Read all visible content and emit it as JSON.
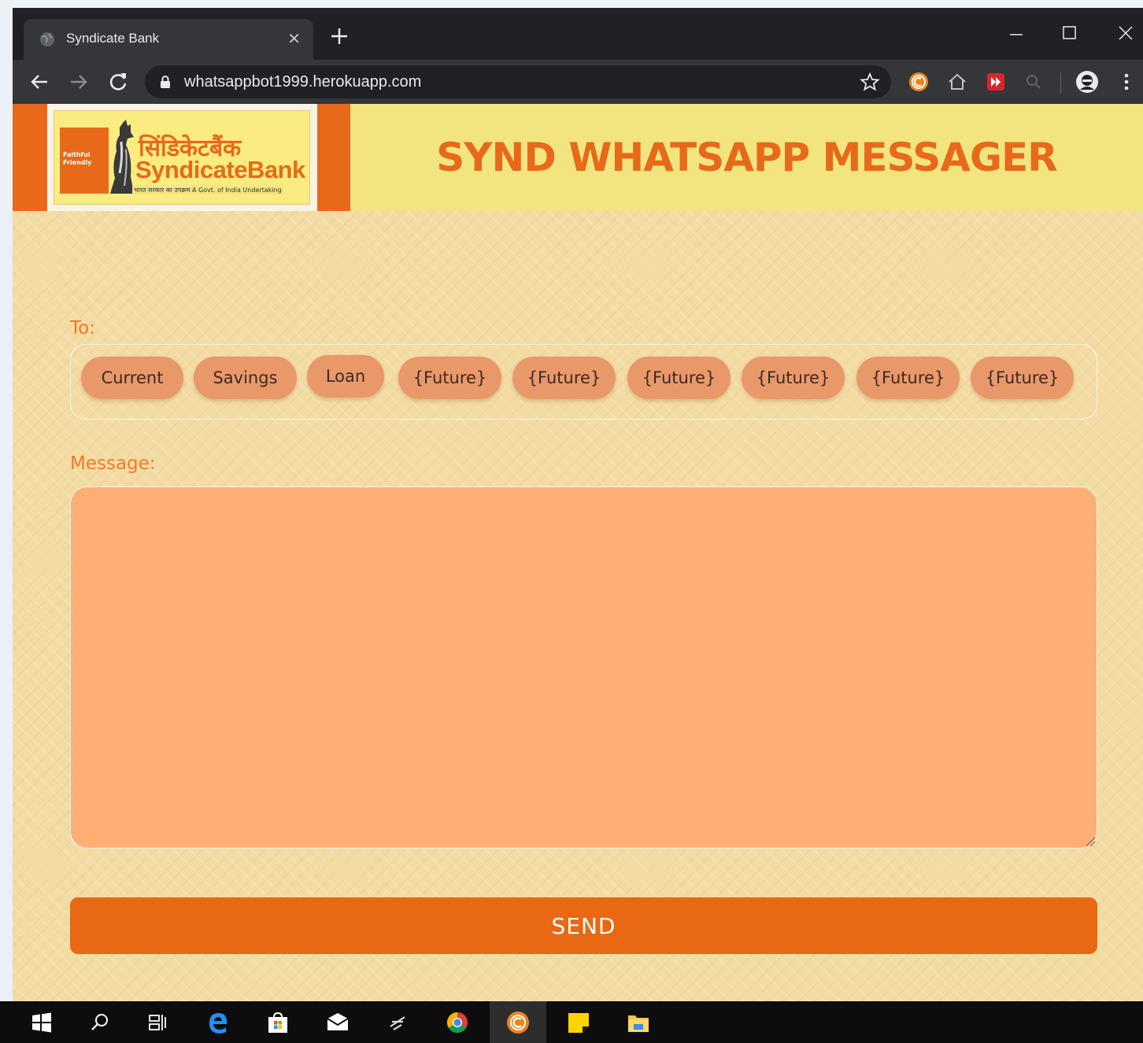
{
  "browser": {
    "tab_title": "Syndicate Bank",
    "url": "whatsappbot1999.herokuapp.com"
  },
  "logo": {
    "hindi_name": "सिंडिकेटबैंक",
    "english_name": "SyndicateBank",
    "tagline": "Faithful Friendly",
    "underline": "भारत सरकार का उपक्रम  A Govt. of India Undertaking"
  },
  "header": {
    "title": "SYND WHATSAPP MESSAGER"
  },
  "form": {
    "to_label": "To:",
    "recipients": [
      {
        "label": "Current"
      },
      {
        "label": "Savings"
      },
      {
        "label": "Loan"
      },
      {
        "label": "{Future}"
      },
      {
        "label": "{Future}"
      },
      {
        "label": "{Future}"
      },
      {
        "label": "{Future}"
      },
      {
        "label": "{Future}"
      },
      {
        "label": "{Future}"
      }
    ],
    "message_label": "Message:",
    "message_value": "",
    "send_label": "SEND"
  },
  "colors": {
    "accent": "#e8691a",
    "page_bg": "#f3dca4",
    "header_bg": "#f2e57f",
    "chip_bg": "#e9986a",
    "textarea_bg": "#ffae75"
  },
  "taskbar_icons": [
    "windows-start-icon",
    "search-icon",
    "task-view-icon",
    "edge-icon",
    "store-icon",
    "mail-icon",
    "app-icon",
    "chrome-icon",
    "coccoc-icon",
    "sticky-notes-icon",
    "file-explorer-icon"
  ]
}
